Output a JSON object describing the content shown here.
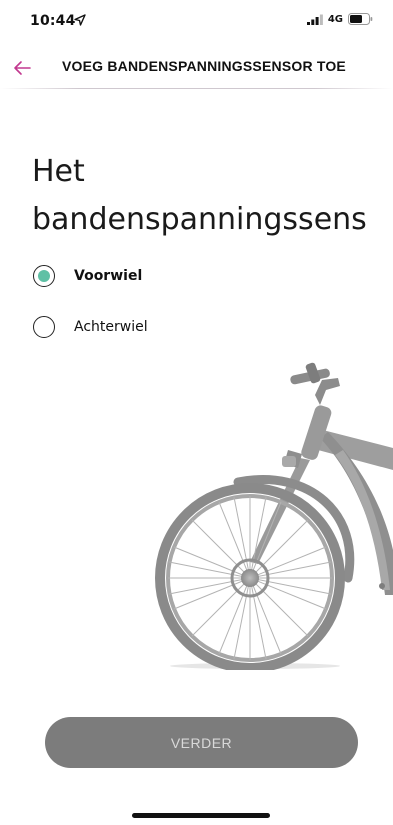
{
  "status_bar": {
    "time": "10:44",
    "network": "4G",
    "icons": [
      "location-arrow-icon",
      "signal-icon",
      "battery-icon"
    ]
  },
  "nav": {
    "title": "VOEG BANDENSPANNINGSSENSOR TOE",
    "back_icon": "arrow-left-icon",
    "accent_color": "#c2388f"
  },
  "heading": {
    "line1": "Het",
    "line2": "bandenspanningssens"
  },
  "options": [
    {
      "label": "Voorwiel",
      "selected": true
    },
    {
      "label": "Achterwiel",
      "selected": false
    }
  ],
  "radio_color": "#5fc0a5",
  "button": {
    "label": "VERDER",
    "enabled": false
  }
}
